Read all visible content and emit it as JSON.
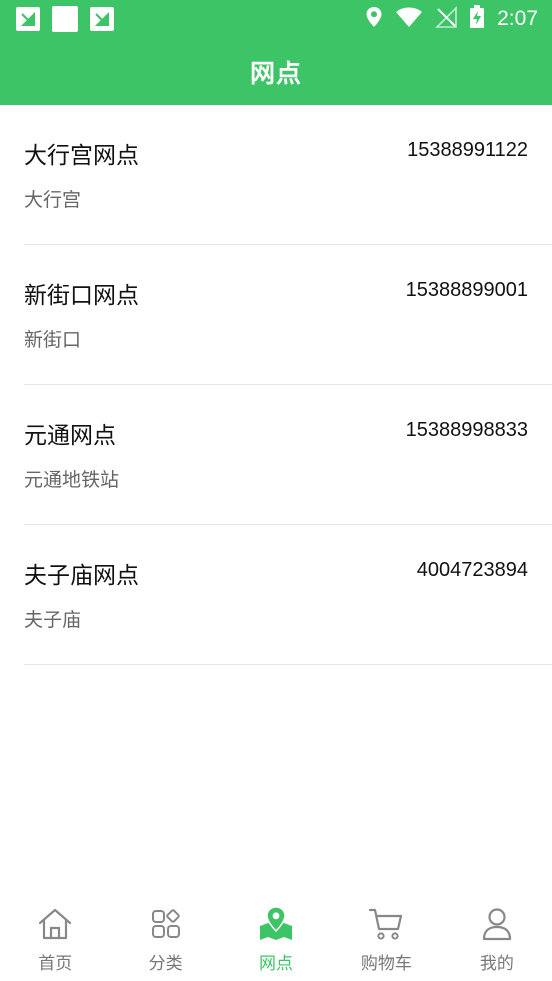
{
  "status_bar": {
    "time": "2:07",
    "icons": [
      "app-notification-icon",
      "blank-notification-icon",
      "app-notification-icon",
      "location-icon",
      "wifi-icon",
      "no-signal-icon",
      "battery-charging-icon"
    ]
  },
  "header": {
    "title": "网点"
  },
  "outlets": [
    {
      "name": "大行宫网点",
      "phone": "15388991122",
      "address": "大行宫"
    },
    {
      "name": "新街口网点",
      "phone": "15388899001",
      "address": "新街口"
    },
    {
      "name": "元通网点",
      "phone": "15388998833",
      "address": "元通地铁站"
    },
    {
      "name": "夫子庙网点",
      "phone": "4004723894",
      "address": "夫子庙"
    }
  ],
  "nav": {
    "items": [
      {
        "label": "首页",
        "icon": "home-icon"
      },
      {
        "label": "分类",
        "icon": "category-icon"
      },
      {
        "label": "网点",
        "icon": "map-pin-icon",
        "active": true
      },
      {
        "label": "购物车",
        "icon": "cart-icon"
      },
      {
        "label": "我的",
        "icon": "user-icon"
      }
    ]
  },
  "colors": {
    "brand": "#3cc466",
    "inactive": "#777777",
    "divider": "#e6e6e6"
  }
}
